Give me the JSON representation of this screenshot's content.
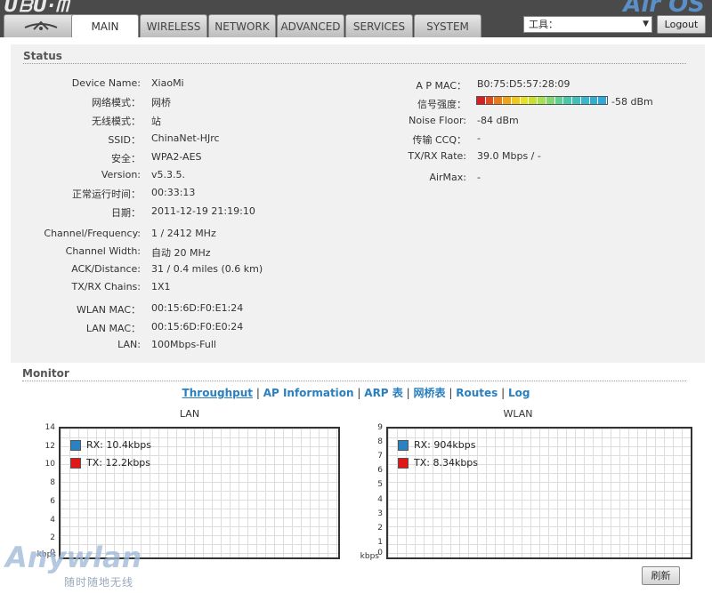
{
  "header": {
    "logo": "ᑌᗷᑌ·ᗰ",
    "product": "Air OS",
    "tabs": [
      {
        "label": "",
        "icon": "ubiquiti-logo-icon"
      },
      {
        "label": "MAIN"
      },
      {
        "label": "WIRELESS"
      },
      {
        "label": "NETWORK"
      },
      {
        "label": "ADVANCED"
      },
      {
        "label": "SERVICES"
      },
      {
        "label": "SYSTEM"
      }
    ],
    "tools_value": "工具：",
    "logout_label": "Logout"
  },
  "status": {
    "title": "Status",
    "left_rows": [
      {
        "label": "Device Name:",
        "value": "XiaoMi"
      },
      {
        "label": "网络模式：",
        "value": "网桥"
      },
      {
        "label": "无线模式：",
        "value": "站"
      },
      {
        "label": "SSID：",
        "value": "ChinaNet-HJrc"
      },
      {
        "label": "安全：",
        "value": "WPA2-AES"
      },
      {
        "label": "Version:",
        "value": "v5.3.5."
      },
      {
        "label": "正常运行时间：",
        "value": "00:33:13"
      },
      {
        "label": "日期：",
        "value": "2011-12-19 21:19:10"
      },
      {
        "label": "Channel/Frequency:",
        "value": "1 / 2412 MHz"
      },
      {
        "label": "Channel Width:",
        "value": "自动 20 MHz"
      },
      {
        "label": "ACK/Distance:",
        "value": "31 / 0.4 miles (0.6 km)"
      },
      {
        "label": "TX/RX Chains:",
        "value": "1X1"
      },
      {
        "label": "WLAN MAC：",
        "value": "00:15:6D:F0:E1:24"
      },
      {
        "label": "LAN MAC：",
        "value": "00:15:6D:F0:E0:24"
      },
      {
        "label": "LAN:",
        "value": "100Mbps-Full"
      }
    ],
    "right_rows": [
      {
        "label": "A P MAC：",
        "value": "B0:75:D5:57:28:09"
      },
      {
        "label": "信号强度：",
        "value": "-58 dBm"
      },
      {
        "label": "Noise Floor:",
        "value": "-84 dBm"
      },
      {
        "label": "传输 CCQ：",
        "value": "-"
      },
      {
        "label": "TX/RX Rate:",
        "value": "39.0 Mbps / -"
      },
      {
        "label": "AirMax:",
        "value": "-"
      }
    ],
    "signal_colors": [
      "#d42020",
      "#e04a1c",
      "#ea7a18",
      "#f0a418",
      "#f2c81c",
      "#e8e020",
      "#c8e030",
      "#a8e050",
      "#80d870",
      "#60d090",
      "#48c8a8",
      "#40c0b8",
      "#38b8c8",
      "#30b0d0",
      "#30a8d8"
    ]
  },
  "monitor": {
    "title": "Monitor",
    "links": [
      {
        "label": "Throughput",
        "current": true
      },
      {
        "label": "AP Information"
      },
      {
        "label": "ARP 表"
      },
      {
        "label": "网桥表"
      },
      {
        "label": "Routes"
      },
      {
        "label": "Log"
      }
    ],
    "separator": "|",
    "refresh_label": "刷新"
  },
  "chart_data": [
    {
      "type": "line",
      "title": "LAN",
      "ylabel": "kbps",
      "ylim": [
        0,
        14
      ],
      "yticks": [
        "0",
        "2",
        "4",
        "6",
        "8",
        "10",
        "12",
        "14"
      ],
      "series": [
        {
          "name": "RX: 10.4kbps",
          "color": "#2a82c0",
          "values": []
        },
        {
          "name": "TX: 12.2kbps",
          "color": "#e01818",
          "values": []
        }
      ]
    },
    {
      "type": "line",
      "title": "WLAN",
      "ylabel": "kbps",
      "ylim": [
        0,
        9
      ],
      "yticks": [
        "0",
        "1",
        "2",
        "3",
        "4",
        "5",
        "6",
        "7",
        "8",
        "9"
      ],
      "series": [
        {
          "name": "RX: 904kbps",
          "color": "#2a82c0",
          "values": []
        },
        {
          "name": "TX: 8.34kbps",
          "color": "#e01818",
          "values": []
        }
      ]
    }
  ],
  "watermark": {
    "main": "Anywlan",
    "sub": "随时随地无线"
  }
}
